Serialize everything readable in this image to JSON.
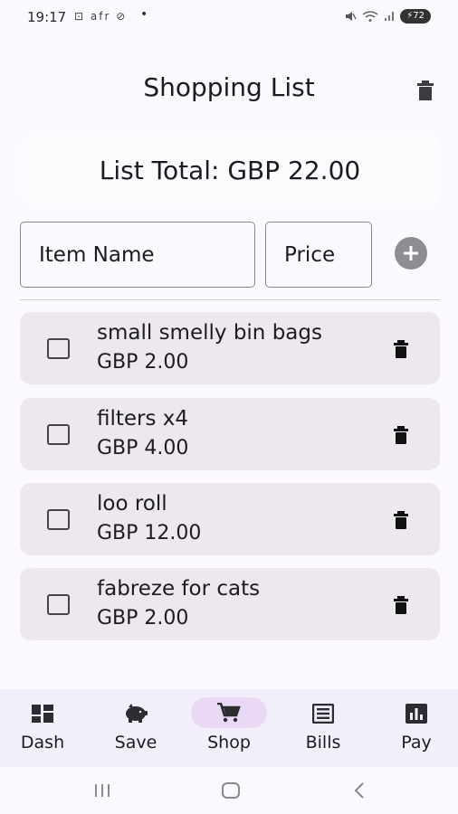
{
  "status_bar": {
    "time": "19:17",
    "left_icons": "⊡ afr ⊘",
    "dot": "•",
    "battery": "72"
  },
  "header": {
    "title": "Shopping List"
  },
  "summary": {
    "total_text": "List Total: GBP 22.00"
  },
  "form": {
    "name_placeholder": "Item Name",
    "price_placeholder": "Price"
  },
  "items": [
    {
      "name": "small smelly bin bags",
      "price": "GBP 2.00",
      "checked": false
    },
    {
      "name": "filters x4",
      "price": "GBP 4.00",
      "checked": false
    },
    {
      "name": "loo roll",
      "price": "GBP 12.00",
      "checked": false
    },
    {
      "name": "fabreze for cats",
      "price": "GBP 2.00",
      "checked": false
    }
  ],
  "nav": {
    "items": [
      {
        "label": "Dash",
        "icon": "dashboard-icon"
      },
      {
        "label": "Save",
        "icon": "piggy-bank-icon"
      },
      {
        "label": "Shop",
        "icon": "shopping-cart-icon",
        "active": true
      },
      {
        "label": "Bills",
        "icon": "receipt-icon"
      },
      {
        "label": "Pay",
        "icon": "bar-chart-icon"
      }
    ]
  },
  "colors": {
    "background": "#fbf9fd",
    "card": "#ede8f0",
    "nav_background": "#f2effa",
    "nav_active": "#ead9f5",
    "add_button": "#8e8d92"
  }
}
